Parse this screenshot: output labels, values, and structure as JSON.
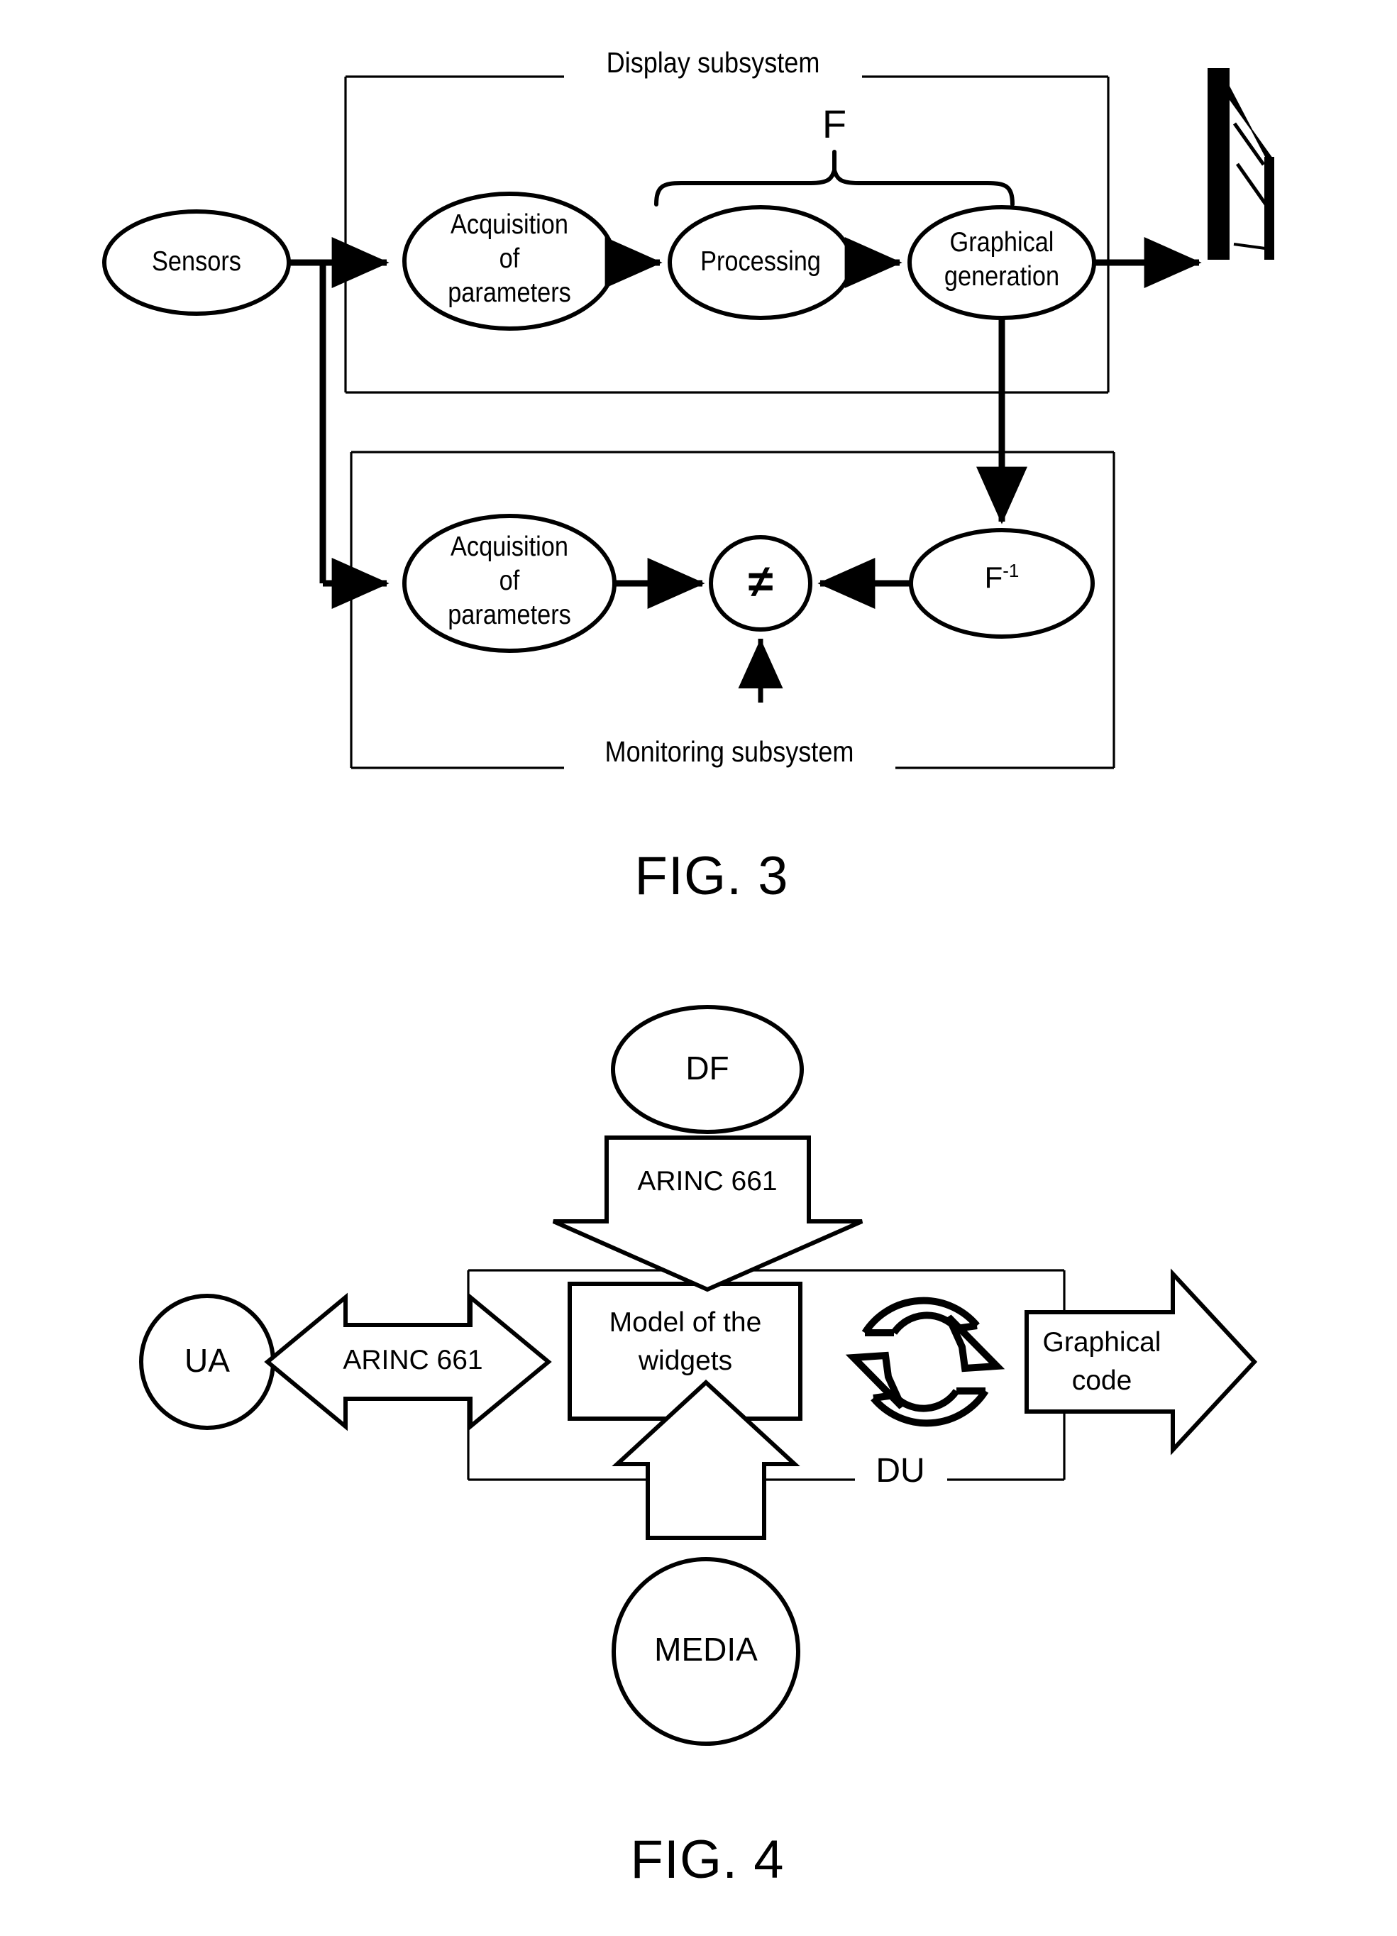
{
  "figures": [
    {
      "id": "fig3",
      "caption": "FIG. 3",
      "subsystems": {
        "display": "Display subsystem",
        "monitoring": "Monitoring subsystem"
      },
      "nodes": {
        "sensors": "Sensors",
        "acquisition_display_line1": "Acquisition",
        "acquisition_display_line2": "of",
        "acquisition_display_line3": "parameters",
        "processing": "Processing",
        "graphical_generation_line1": "Graphical",
        "graphical_generation_line2": "generation",
        "acquisition_monitor_line1": "Acquisition",
        "acquisition_monitor_line2": "of",
        "acquisition_monitor_line3": "parameters",
        "comparator": "≠",
        "inverse_function": "F",
        "inverse_function_exponent": "-1"
      },
      "annotations": {
        "brace_label": "F"
      },
      "icons": {
        "display_screen": "display-screen-icon"
      }
    },
    {
      "id": "fig4",
      "caption": "FIG. 4",
      "nodes": {
        "df": "DF",
        "ua": "UA",
        "media": "MEDIA",
        "model_line1": "Model of the",
        "model_line2": "widgets"
      },
      "arrows": {
        "arinc_top": "ARINC 661",
        "arinc_left": "ARINC 661",
        "graphical_code_line1": "Graphical",
        "graphical_code_line2": "code"
      },
      "container_label": "DU",
      "icons": {
        "sync_cycle": "sync-refresh-icon"
      }
    }
  ],
  "style": {
    "ink": "#000000",
    "paper": "#ffffff"
  }
}
